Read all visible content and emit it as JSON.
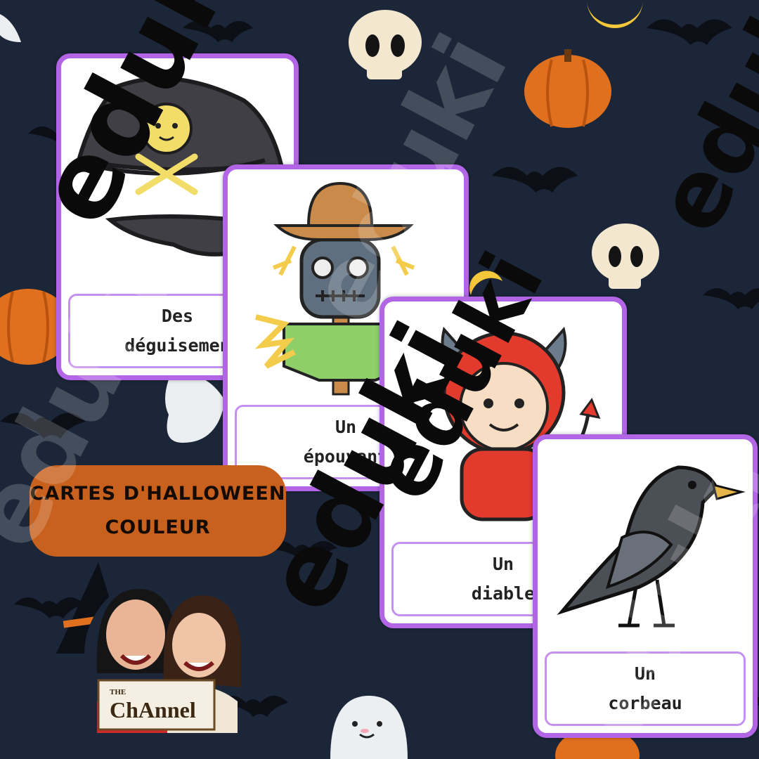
{
  "colors": {
    "background": "#1b2638",
    "card_border": "#b266e6",
    "pill": "#c8611e",
    "pumpkin": "#e0701e"
  },
  "cards": [
    {
      "id": "pirate",
      "line1": "Des",
      "line2": "déguisemen",
      "icon": "pirate-hat-icon"
    },
    {
      "id": "scarecrow",
      "line1": "Un",
      "line2": "épouvant",
      "icon": "scarecrow-icon"
    },
    {
      "id": "devil",
      "line1": "Un",
      "line2": "diable",
      "icon": "devil-icon"
    },
    {
      "id": "crow",
      "line1": "Un",
      "line2": "corbeau",
      "icon": "crow-icon"
    }
  ],
  "title": {
    "line1": "CARTES D'HALLOWEEN",
    "line2": "COULEUR"
  },
  "logo": {
    "small": "THE",
    "brand": "ChAnnel"
  },
  "watermark": "eduki"
}
